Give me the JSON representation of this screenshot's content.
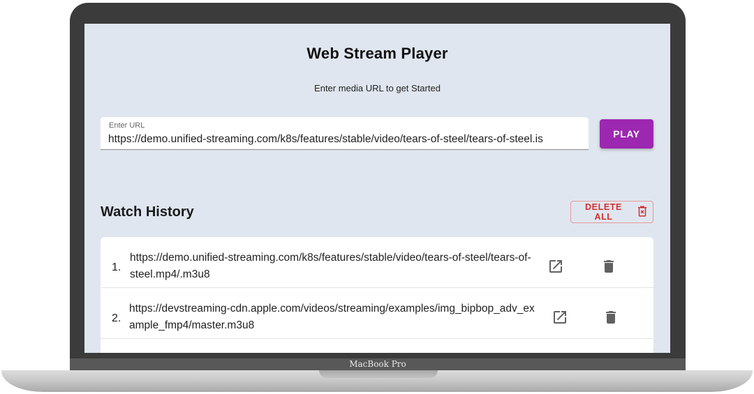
{
  "device": {
    "brand_label": "MacBook Pro"
  },
  "header": {
    "title": "Web Stream Player",
    "subtitle": "Enter media URL to get Started"
  },
  "url_input": {
    "label": "Enter URL",
    "value": "https://demo.unified-streaming.com/k8s/features/stable/video/tears-of-steel/tears-of-steel.is"
  },
  "play_button": {
    "label": "PLAY"
  },
  "history": {
    "title": "Watch History",
    "delete_all_label": "DELETE ALL",
    "items": [
      {
        "index": "1.",
        "url": "https://demo.unified-streaming.com/k8s/features/stable/video/tears-of-steel/tears-of-steel.mp4/.m3u8",
        "open_icon": "open-in-new-icon",
        "delete_icon": "trash-icon"
      },
      {
        "index": "2.",
        "url": "https://devstreaming-cdn.apple.com/videos/streaming/examples/img_bipbop_adv_example_fmp4/master.m3u8",
        "open_icon": "open-in-new-icon",
        "delete_icon": "trash-icon"
      }
    ]
  },
  "colors": {
    "accent": "#9c27b0",
    "danger": "#d32f2f",
    "background": "#e0e6ef",
    "bezel": "#3b3b3b"
  }
}
